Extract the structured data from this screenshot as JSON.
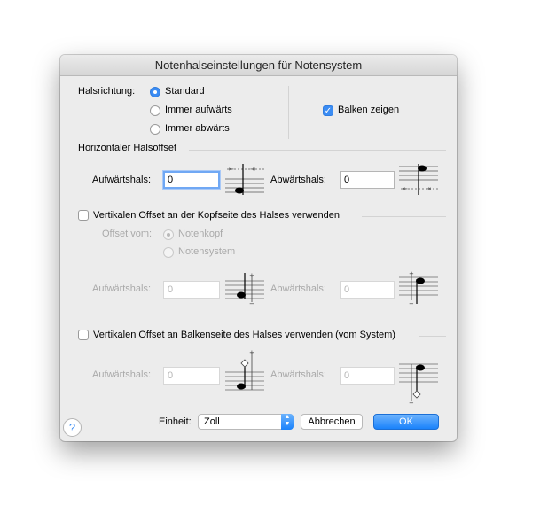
{
  "window": {
    "title": "Notenhalseinstellungen für Notensystem"
  },
  "direction": {
    "label": "Halsrichtung:",
    "options": [
      "Standard",
      "Immer aufwärts",
      "Immer abwärts"
    ],
    "selected": "Standard"
  },
  "beams": {
    "label": "Balken zeigen",
    "checked": true
  },
  "horizontal": {
    "heading": "Horizontaler Halsoffset",
    "up_label": "Aufwärtshals:",
    "up_value": "0",
    "down_label": "Abwärtshals:",
    "down_value": "0"
  },
  "head_side": {
    "checkbox_label": "Vertikalen Offset an der Kopfseite des Halses verwenden",
    "checked": false,
    "offset_from_label": "Offset vom:",
    "offset_options": [
      "Notenkopf",
      "Notensystem"
    ],
    "offset_selected": "Notenkopf",
    "up_label": "Aufwärtshals:",
    "up_value": "0",
    "down_label": "Abwärtshals:",
    "down_value": "0"
  },
  "beam_side": {
    "checkbox_label": "Vertikalen Offset an Balkenseite des Halses verwenden (vom System)",
    "checked": false,
    "up_label": "Aufwärtshals:",
    "up_value": "0",
    "down_label": "Abwärtshals:",
    "down_value": "0"
  },
  "footer": {
    "unit_label": "Einheit:",
    "unit_value": "Zoll",
    "cancel_label": "Abbrechen",
    "ok_label": "OK",
    "help_label": "?"
  },
  "colors": {
    "accent": "#3b8cf3",
    "dialog_bg": "#ececec"
  },
  "icons": [
    "radio-icon",
    "checkbox-icon",
    "stem-diagram-icon",
    "help-icon",
    "popup-arrows-icon"
  ]
}
